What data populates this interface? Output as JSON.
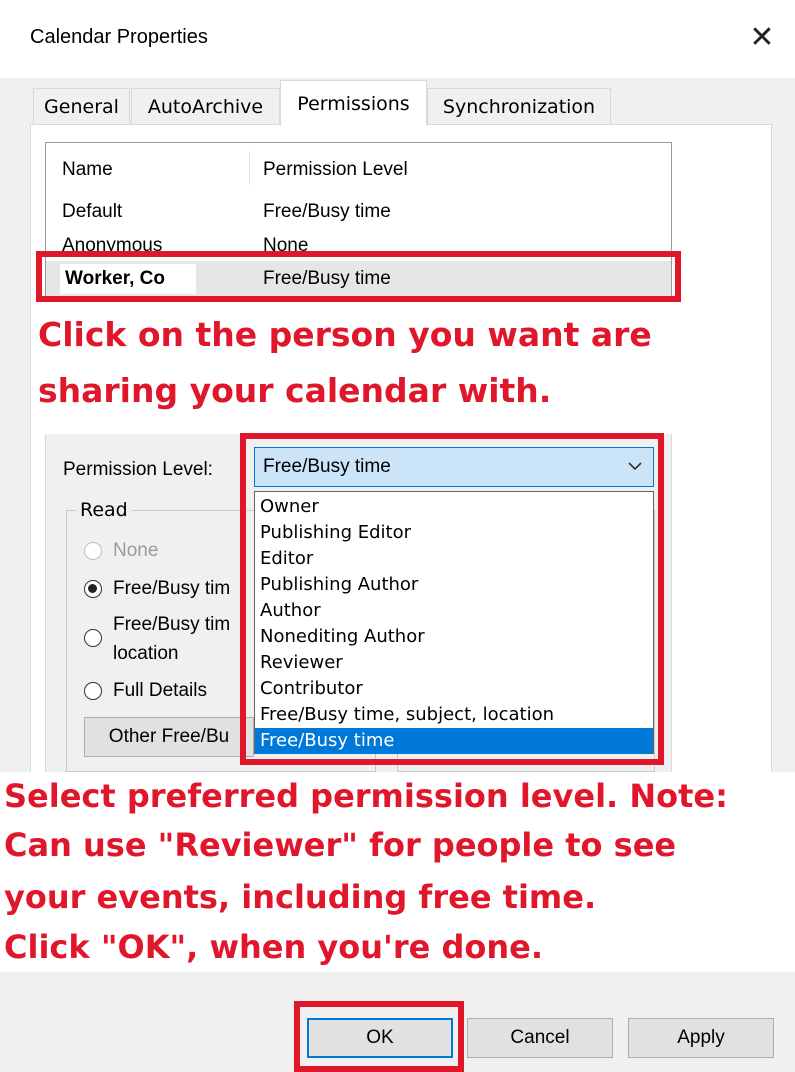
{
  "window": {
    "title": "Calendar Properties",
    "close_glyph": "✕"
  },
  "tabs": [
    {
      "label": "General",
      "active": false
    },
    {
      "label": "AutoArchive",
      "active": false
    },
    {
      "label": "Permissions",
      "active": true
    },
    {
      "label": "Synchronization",
      "active": false
    }
  ],
  "permissions_list": {
    "columns": [
      "Name",
      "Permission Level"
    ],
    "rows": [
      {
        "name": "Default",
        "level": "Free/Busy time"
      },
      {
        "name": "Anonymous",
        "level": "None"
      },
      {
        "name": "Worker, Co",
        "level": "Free/Busy time",
        "selected": true
      }
    ]
  },
  "permission_level": {
    "label": "Permission Level:",
    "selected": "Free/Busy time",
    "options": [
      "Owner",
      "Publishing Editor",
      "Editor",
      "Publishing Author",
      "Author",
      "Nonediting Author",
      "Reviewer",
      "Contributor",
      "Free/Busy time, subject, location",
      "Free/Busy time"
    ]
  },
  "read_group": {
    "title": "Read",
    "options": [
      {
        "label": "None",
        "checked": false,
        "disabled": true
      },
      {
        "label": "Free/Busy tim",
        "checked": true,
        "disabled": false
      },
      {
        "label": "Free/Busy tim",
        "label2": "location",
        "checked": false,
        "disabled": false
      },
      {
        "label": "Full Details",
        "checked": false,
        "disabled": false
      }
    ],
    "other_button": "Other Free/Bu"
  },
  "annotations": {
    "step1_line1": "Click on the person you want are",
    "step1_line2": "sharing your calendar with.",
    "step2_line1": "Select preferred permission level. Note:",
    "step2_line2": "Can use \"Reviewer\" for people to see",
    "step2_line3": "your events, including free time.",
    "step2_line4": "Click \"OK\", when you're done.",
    "color": "#e0162b"
  },
  "buttons": {
    "ok": "OK",
    "cancel": "Cancel",
    "apply": "Apply"
  },
  "colors": {
    "accent": "#0078d7",
    "dialog_bg": "#f0f0f0"
  }
}
